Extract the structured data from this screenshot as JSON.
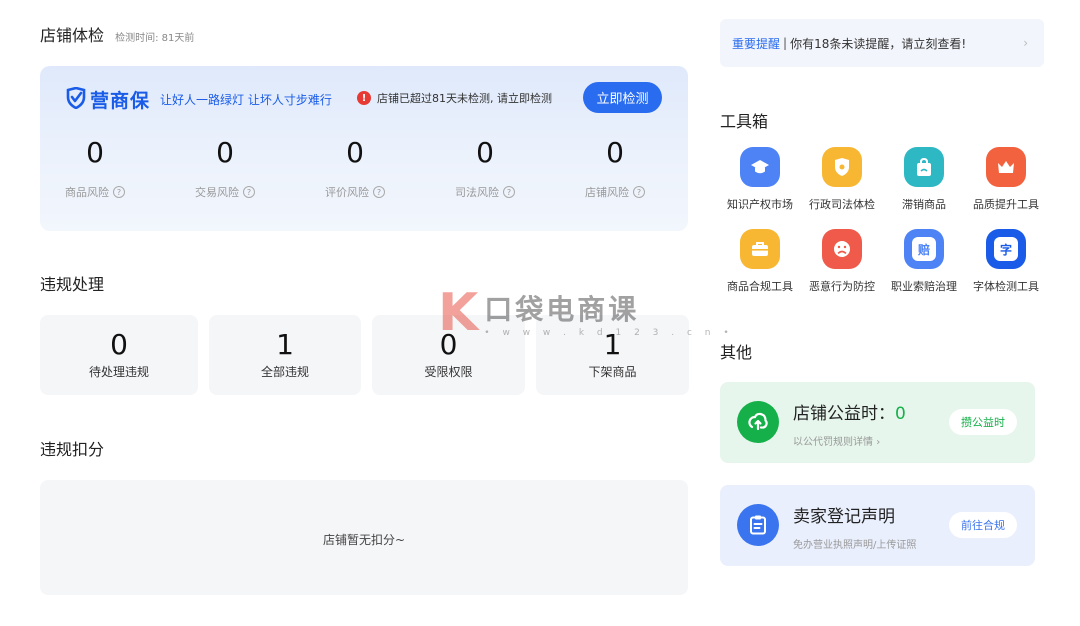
{
  "health": {
    "title": "店铺体检",
    "check_time": "检测时间: 81天前",
    "brand_logo": "营商保",
    "slogan": "让好人一路绿灯 让坏人寸步难行",
    "warning": "店铺已超过81天未检测, 请立即检测",
    "check_button": "立即检测",
    "risks": [
      {
        "value": "0",
        "label": "商品风险"
      },
      {
        "value": "0",
        "label": "交易风险"
      },
      {
        "value": "0",
        "label": "评价风险"
      },
      {
        "value": "0",
        "label": "司法风险"
      },
      {
        "value": "0",
        "label": "店铺风险"
      }
    ]
  },
  "violation": {
    "title": "违规处理",
    "cards": [
      {
        "value": "0",
        "label": "待处理违规"
      },
      {
        "value": "1",
        "label": "全部违规"
      },
      {
        "value": "0",
        "label": "受限权限"
      },
      {
        "value": "1",
        "label": "下架商品"
      }
    ]
  },
  "deduction": {
    "title": "违规扣分",
    "empty_text": "店铺暂无扣分~"
  },
  "notice": {
    "important": "重要提醒",
    "separator": "|",
    "message": "你有18条未读提醒，请立刻查看!",
    "arrow": "›"
  },
  "toolbox": {
    "title": "工具箱",
    "tools": [
      {
        "label": "知识产权市场",
        "icon": "graduation-cap-icon",
        "color": "#4d83f5"
      },
      {
        "label": "行政司法体检",
        "icon": "shield-star-icon",
        "color": "#f7b733"
      },
      {
        "label": "滞销商品",
        "icon": "shopping-bag-icon",
        "color": "#2db8c4"
      },
      {
        "label": "品质提升工具",
        "icon": "crown-icon",
        "color": "#f2623e"
      },
      {
        "label": "商品合规工具",
        "icon": "briefcase-icon",
        "color": "#f7b733"
      },
      {
        "label": "恶意行为防控",
        "icon": "sad-face-icon",
        "color": "#ef5a4a"
      },
      {
        "label": "职业索赔治理",
        "icon": "compensation-icon",
        "glyph": "赔",
        "color": "#4d83f5"
      },
      {
        "label": "字体检测工具",
        "icon": "font-check-icon",
        "glyph": "字",
        "color": "#1a5ce8"
      }
    ]
  },
  "other": {
    "title": "其他",
    "welfare": {
      "title_prefix": "店铺公益时：",
      "hours": "0",
      "sub": "以公代罚规则详情",
      "sub_arrow": "›",
      "button": "攒公益时",
      "bg": "#e6f6ec",
      "accent": "#16b04a"
    },
    "seller": {
      "title": "卖家登记声明",
      "sub": "免办营业执照声明/上传证照",
      "button": "前往合规",
      "bg": "#e9effc",
      "accent": "#3a74ee"
    }
  },
  "watermark": {
    "letter": "K",
    "text": "口袋电商课",
    "url": "• w w w . k d 1 2 3 . c n •"
  }
}
